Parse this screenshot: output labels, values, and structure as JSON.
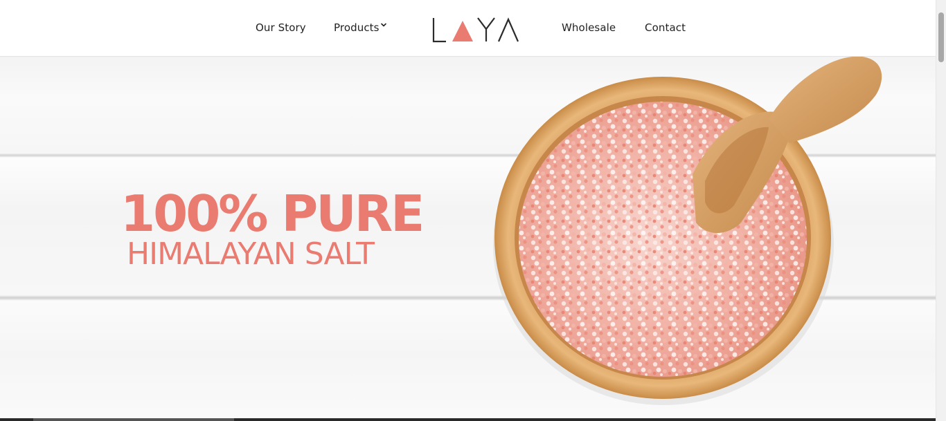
{
  "nav": {
    "left_items": [
      {
        "label": "Our Story"
      },
      {
        "label": "Products"
      }
    ],
    "right_items": [
      {
        "label": "Wholesale"
      },
      {
        "label": "Contact"
      }
    ],
    "logo_text": "LAYA"
  },
  "hero": {
    "headline": "100% PURE",
    "subheadline": "HIMALAYAN SALT"
  },
  "colors": {
    "accent": "#ea7b70",
    "logo_dark": "#2b2b2b",
    "nav_text": "#222222"
  },
  "icons": {
    "products_dropdown": "chevron-down-icon"
  }
}
